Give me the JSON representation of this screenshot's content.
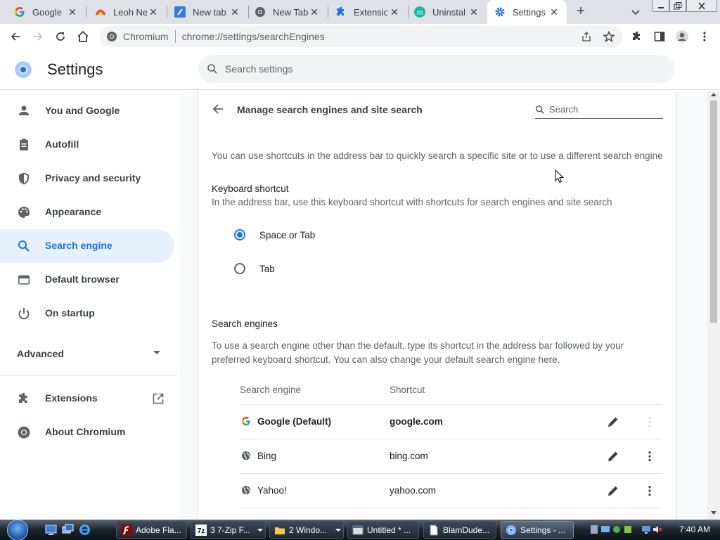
{
  "browser": {
    "tabs": [
      {
        "title": "Google",
        "icon": "google-g-icon"
      },
      {
        "title": "Leoh New",
        "icon": "leoh-icon"
      },
      {
        "title": "New tab",
        "icon": "edit-pen-icon"
      },
      {
        "title": "New Tab",
        "icon": "chromium-icon"
      },
      {
        "title": "Extensions",
        "icon": "puzzle-icon"
      },
      {
        "title": "Uninstall",
        "icon": "m-logo-icon"
      },
      {
        "title": "Settings",
        "icon": "gear-icon",
        "active": true
      }
    ],
    "omnibox": {
      "chip_label": "Chromium",
      "url": "chrome://settings/searchEngines"
    }
  },
  "settings": {
    "title": "Settings",
    "search_placeholder": "Search settings",
    "sidebar": {
      "items": [
        {
          "label": "You and Google",
          "icon": "person-icon"
        },
        {
          "label": "Autofill",
          "icon": "clipboard-icon"
        },
        {
          "label": "Privacy and security",
          "icon": "shield-icon"
        },
        {
          "label": "Appearance",
          "icon": "palette-icon"
        },
        {
          "label": "Search engine",
          "icon": "search-icon",
          "selected": true
        },
        {
          "label": "Default browser",
          "icon": "browser-window-icon"
        },
        {
          "label": "On startup",
          "icon": "power-icon"
        }
      ],
      "advanced_label": "Advanced",
      "extensions_label": "Extensions",
      "about_label": "About Chromium"
    },
    "page": {
      "title": "Manage search engines and site search",
      "search_placeholder": "Search",
      "intro": "You can use shortcuts in the address bar to quickly search a specific site or to use a different search engine",
      "keyboard_shortcut": {
        "heading": "Keyboard shortcut",
        "description": "In the address bar, use this keyboard shortcut with shortcuts for search engines and site search",
        "options": [
          {
            "label": "Space or Tab",
            "checked": true
          },
          {
            "label": "Tab",
            "checked": false
          }
        ]
      },
      "search_engines": {
        "heading": "Search engines",
        "description": "To use a search engine other than the default, type its shortcut in the address bar followed by your preferred keyboard shortcut. You can also change your default search engine here.",
        "columns": [
          "Search engine",
          "Shortcut"
        ],
        "rows": [
          {
            "name": "Google (Default)",
            "shortcut": "google.com",
            "icon": "google-g-icon"
          },
          {
            "name": "Bing",
            "shortcut": "bing.com",
            "icon": "globe-icon"
          },
          {
            "name": "Yahoo!",
            "shortcut": "yahoo.com",
            "icon": "globe-icon"
          }
        ]
      }
    }
  },
  "taskbar": {
    "buttons": [
      {
        "label": "Adobe Fla...",
        "icon": "flash-icon"
      },
      {
        "label": "3 7-Zip F...",
        "icon": "7zip-icon"
      },
      {
        "label": "2 Windo...",
        "icon": "folder-icon"
      },
      {
        "label": "Untitled * ...",
        "icon": "app-window-icon"
      },
      {
        "label": "BlamDude...",
        "icon": "document-icon"
      },
      {
        "label": "Settings - ...",
        "icon": "chromium-icon",
        "active": true
      }
    ],
    "clock": "7:40 AM"
  },
  "colors": {
    "accent": "#1a73e8",
    "selected_bg": "#e8f0fe",
    "tabstrip": "#dee1e6"
  }
}
